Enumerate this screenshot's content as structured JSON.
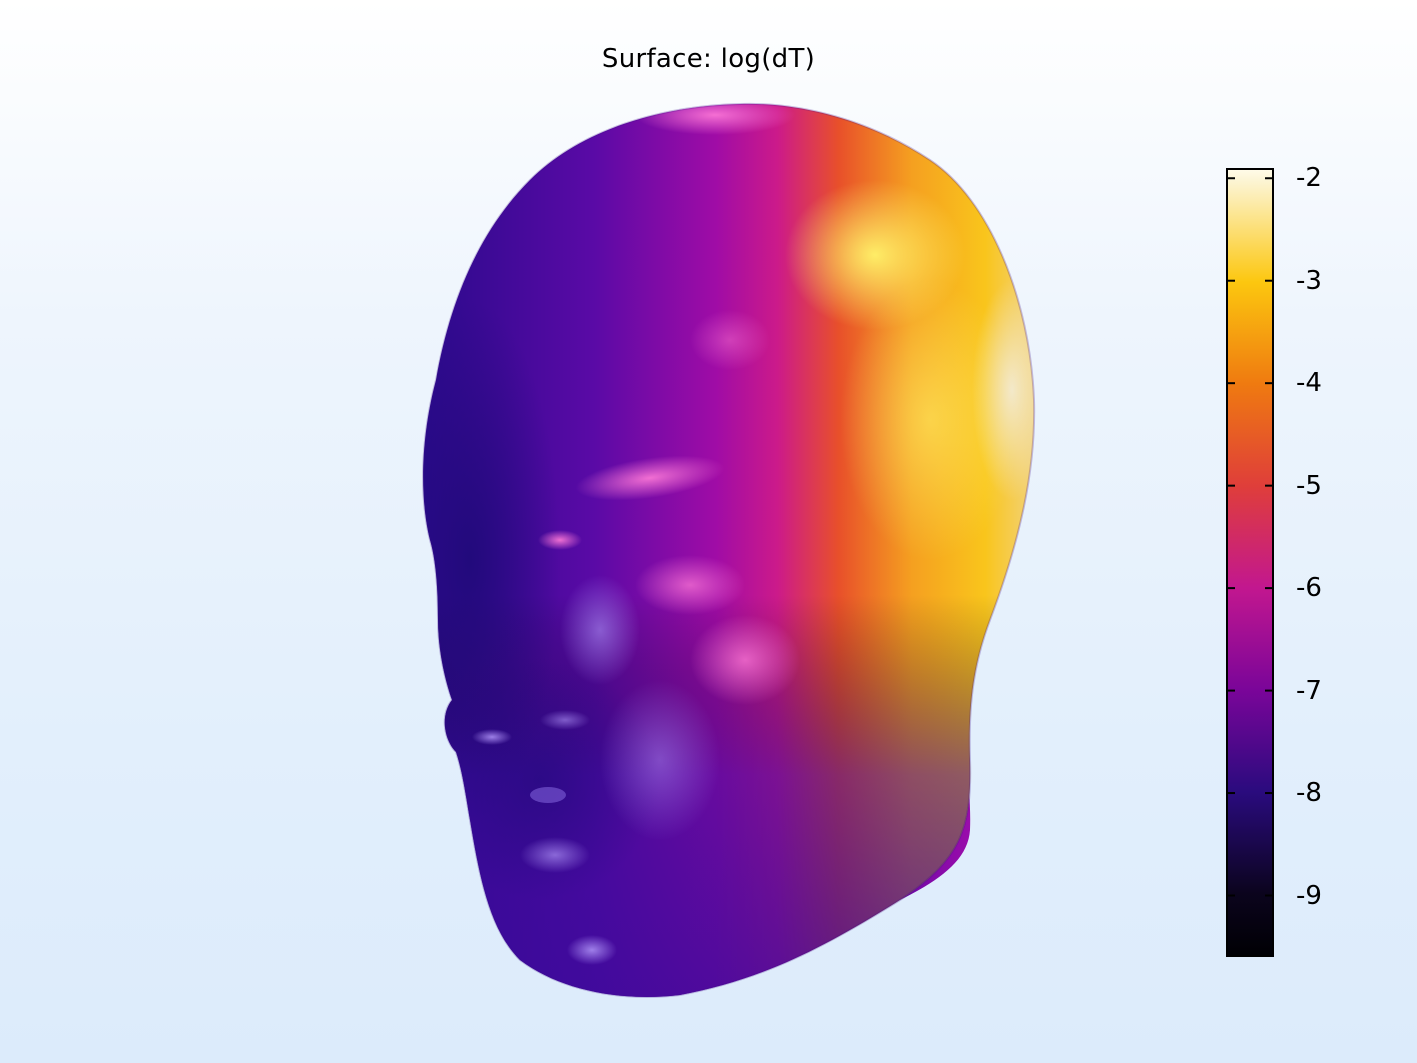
{
  "plot": {
    "title": "Surface: log(dT)"
  },
  "colorbar": {
    "colormap": "inferno-like (black-purple-magenta-orange-yellow-white)",
    "range": [
      -9.6,
      -1.9
    ],
    "tick_values": [
      -2,
      -3,
      -4,
      -5,
      -6,
      -7,
      -8,
      -9
    ],
    "tick_labels": [
      "-2",
      "-3",
      "-4",
      "-5",
      "-6",
      "-7",
      "-8",
      "-9"
    ],
    "colors": [
      "#fcf5d5",
      "#fcc70f",
      "#ef7a10",
      "#df3e3a",
      "#c2178f",
      "#7a0599",
      "#2a0b7e",
      "#0b041d"
    ]
  },
  "scene": {
    "object": "head surface mesh",
    "background_colors": [
      "#ffffff",
      "#dcebfb"
    ]
  }
}
